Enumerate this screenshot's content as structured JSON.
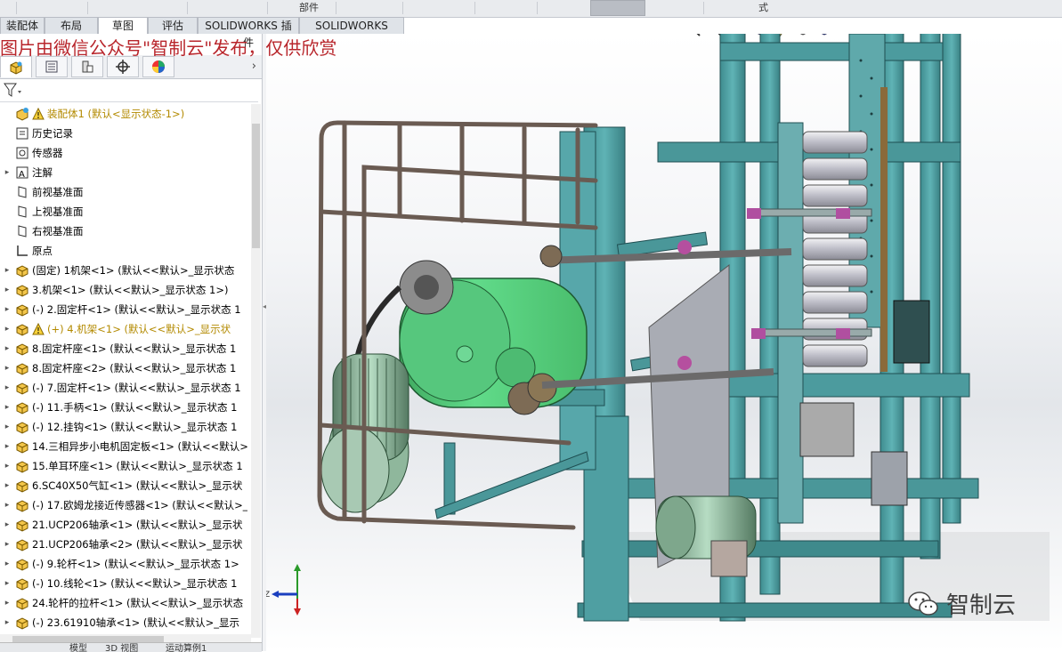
{
  "top_strip": {
    "parts_label": "部件",
    "style_label": "式"
  },
  "tabs": [
    {
      "label": "装配体",
      "active": false
    },
    {
      "label": "布局",
      "active": false
    },
    {
      "label": "草图",
      "active": true
    },
    {
      "label": "评估",
      "active": false
    },
    {
      "label": "SOLIDWORKS 插件",
      "active": false
    },
    {
      "label": "SOLIDWORKS MBD",
      "active": false
    }
  ],
  "watermark": "图片由微信公众号\"智制云\"发布，仅供欣赏",
  "feature_tree": {
    "root": "装配体1  (默认<显示状态-1>)",
    "items": [
      {
        "label": "历史记录",
        "icon": "history-icon",
        "expand": false
      },
      {
        "label": "传感器",
        "icon": "sensor-icon",
        "expand": false
      },
      {
        "label": "注解",
        "icon": "annotation-icon",
        "expand": true
      },
      {
        "label": "前视基准面",
        "icon": "plane-icon",
        "expand": false
      },
      {
        "label": "上视基准面",
        "icon": "plane-icon",
        "expand": false
      },
      {
        "label": "右视基准面",
        "icon": "plane-icon",
        "expand": false
      },
      {
        "label": "原点",
        "icon": "origin-icon",
        "expand": false
      },
      {
        "label": "(固定) 1机架<1> (默认<<默认>_显示状态",
        "icon": "part-icon",
        "expand": true
      },
      {
        "label": "3.机架<1> (默认<<默认>_显示状态 1>)",
        "icon": "part-icon",
        "expand": true
      },
      {
        "label": "(-) 2.固定杆<1> (默认<<默认>_显示状态 1",
        "icon": "part-icon",
        "expand": true
      },
      {
        "label": "(+) 4.机架<1> (默认<<默认>_显示状",
        "icon": "part-icon",
        "expand": true,
        "warning": true
      },
      {
        "label": "8.固定杆座<1> (默认<<默认>_显示状态 1",
        "icon": "part-icon",
        "expand": true
      },
      {
        "label": "8.固定杆座<2> (默认<<默认>_显示状态 1",
        "icon": "part-icon",
        "expand": true
      },
      {
        "label": "(-) 7.固定杆<1> (默认<<默认>_显示状态 1",
        "icon": "part-icon",
        "expand": true
      },
      {
        "label": "(-) 11.手柄<1> (默认<<默认>_显示状态 1",
        "icon": "part-icon",
        "expand": true
      },
      {
        "label": "(-) 12.挂钩<1> (默认<<默认>_显示状态 1",
        "icon": "part-icon",
        "expand": true
      },
      {
        "label": "14.三相异步小电机固定板<1> (默认<<默认>",
        "icon": "part-icon",
        "expand": true
      },
      {
        "label": "15.单耳环座<1> (默认<<默认>_显示状态 1",
        "icon": "part-icon",
        "expand": true
      },
      {
        "label": "6.SC40X50气缸<1> (默认<<默认>_显示状",
        "icon": "part-icon",
        "expand": true
      },
      {
        "label": "(-) 17.欧姆龙接近传感器<1> (默认<<默认>_",
        "icon": "part-icon",
        "expand": true
      },
      {
        "label": "21.UCP206轴承<1> (默认<<默认>_显示状",
        "icon": "part-icon",
        "expand": true
      },
      {
        "label": "21.UCP206轴承<2> (默认<<默认>_显示状",
        "icon": "part-icon",
        "expand": true
      },
      {
        "label": "(-) 9.轮杆<1> (默认<<默认>_显示状态 1>",
        "icon": "part-icon",
        "expand": true
      },
      {
        "label": "(-) 10.线轮<1> (默认<<默认>_显示状态 1",
        "icon": "part-icon",
        "expand": true
      },
      {
        "label": "24.轮杆的拉杆<1> (默认<<默认>_显示状态",
        "icon": "part-icon",
        "expand": true
      },
      {
        "label": "(-) 23.61910轴承<1> (默认<<默认>_显示",
        "icon": "part-icon",
        "expand": true
      }
    ]
  },
  "bottom_tabs": [
    "模型",
    "3D 视图",
    "运动算例1"
  ],
  "triad": {
    "z_label": "Z"
  },
  "brand": "智制云",
  "colors": {
    "frame_teal": "#4e9da0",
    "motor_green": "#55cf7a",
    "tab_active": "#ffffff",
    "watermark": "#b8252b"
  }
}
